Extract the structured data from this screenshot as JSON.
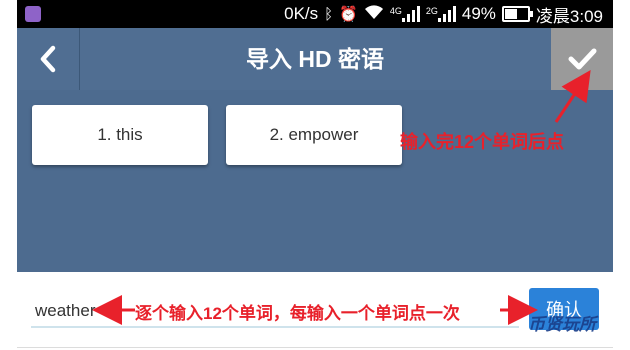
{
  "statusbar": {
    "network_speed": "0K/s",
    "network_type_1": "4G",
    "network_type_2": "2G",
    "battery_percent": "49%",
    "time": "凌晨3:09"
  },
  "navbar": {
    "title": "导入 HD 密语"
  },
  "words": [
    {
      "label": "1. this"
    },
    {
      "label": "2. empower"
    }
  ],
  "annotations": {
    "top": "输入完12个单词后点",
    "bottom": "逐个输入12个单词，每输入一个单词点一次"
  },
  "input": {
    "value": "weather",
    "confirm_label": "确认"
  },
  "watermark": "币贤玩所",
  "colors": {
    "navbar": "#506e92",
    "content": "#4d6b8f",
    "annotation": "#e8212b",
    "confirm": "#2b82d9"
  }
}
